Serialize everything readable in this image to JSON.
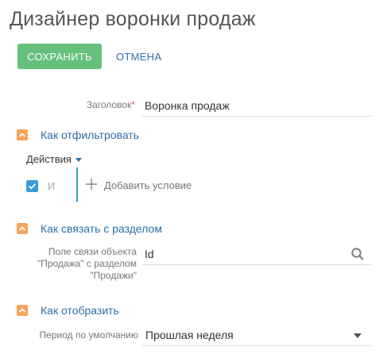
{
  "page": {
    "title": "Дизайнер воронки продаж"
  },
  "toolbar": {
    "save_label": "СОХРАНИТЬ",
    "cancel_label": "ОТМЕНА"
  },
  "header_field": {
    "label": "Заголовок",
    "required_mark": "*",
    "value": "Воронка продаж"
  },
  "filter_section": {
    "title": "Как отфильтровать",
    "actions_label": "Действия",
    "and_label": "И",
    "add_condition_label": "Добавить условие",
    "checkbox_checked": true
  },
  "link_section": {
    "title": "Как связать с разделом",
    "field_label_line1": "Поле связи объекта",
    "field_label_line2": "\"Продажа\" с разделом",
    "field_label_line3": "\"Продажи\"",
    "field_value": "Id"
  },
  "display_section": {
    "title": "Как отобразить",
    "period_label": "Период по умолчанию",
    "period_value": "Прошлая неделя"
  },
  "colors": {
    "save_button": "#64c07a",
    "link_blue": "#2c6ea8",
    "section_toggle": "#f5a35c",
    "checkbox": "#3a9ad9"
  },
  "icons": [
    "collapse-icon",
    "caret-down-icon",
    "checkbox-icon",
    "plus-icon",
    "search-icon",
    "dropdown-arrow-icon"
  ]
}
